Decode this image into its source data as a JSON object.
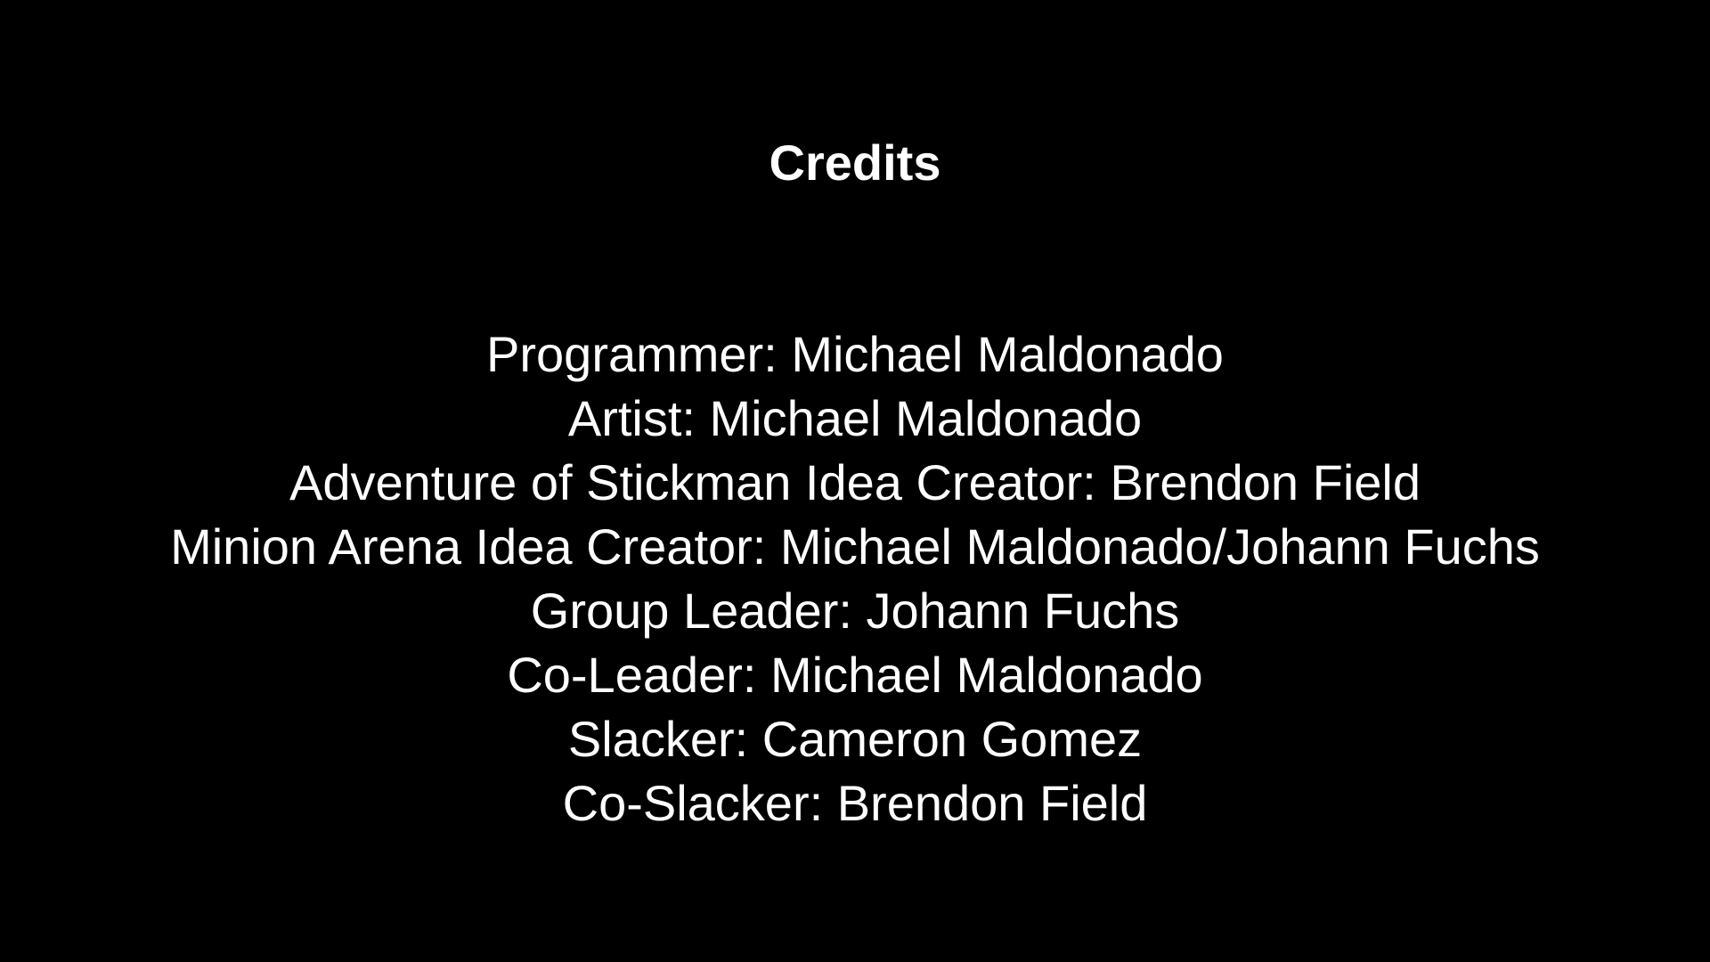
{
  "screen": {
    "title": "Credits",
    "background": "#000000",
    "text_color": "#ffffff"
  },
  "credits": [
    "Programmer: Michael Maldonado",
    "Artist: Michael Maldonado",
    "Adventure of Stickman Idea Creator: Brendon Field",
    "Minion Arena Idea Creator: Michael Maldonado/Johann Fuchs",
    "Group Leader: Johann Fuchs",
    "Co-Leader: Michael Maldonado",
    "Slacker: Cameron Gomez",
    "Co-Slacker: Brendon Field"
  ]
}
